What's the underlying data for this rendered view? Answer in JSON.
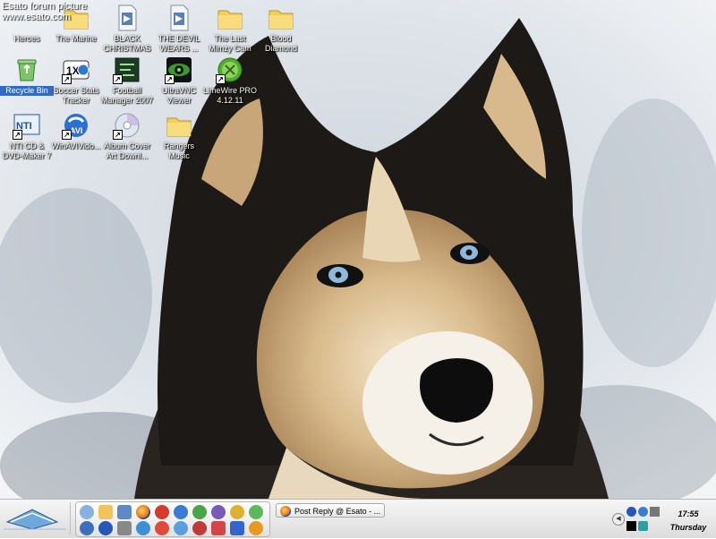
{
  "watermark": {
    "line1": "Esato forum picture",
    "line2": "www.esato.com"
  },
  "desktop_icons": [
    {
      "label": "Heroes"
    },
    {
      "label": "The Marine"
    },
    {
      "label": "BLACK CHRISTMAS"
    },
    {
      "label": "THE DEVIL WEARS ..."
    },
    {
      "label": "The Last Mimzy Cam"
    },
    {
      "label": "Blood Diamond"
    },
    {
      "label": "Recycle Bin"
    },
    {
      "label": "Soccer Stats Tracker"
    },
    {
      "label": "Football Manager 2007"
    },
    {
      "label": "UltraVNC Viewer"
    },
    {
      "label": "LimeWire PRO 4.12.11"
    },
    {
      "label": "NTI CD & DVD-Maker 7"
    },
    {
      "label": "WinAVIVido..."
    },
    {
      "label": "Album Cover Art Downl..."
    },
    {
      "label": "Rangers Music"
    }
  ],
  "taskbar": {
    "task_button_label": "Post Reply @ Esato - ...",
    "clock_time": "17:55",
    "clock_day": "Thursday",
    "tray_arrow": "◀"
  },
  "colors": {
    "folder": "#f2cf5b",
    "selection": "#316ac5",
    "taskbar": "#e8e8e8"
  },
  "icons": {
    "folder": "folder-icon",
    "video": "video-file-icon",
    "recycle": "recycle-bin-icon"
  }
}
